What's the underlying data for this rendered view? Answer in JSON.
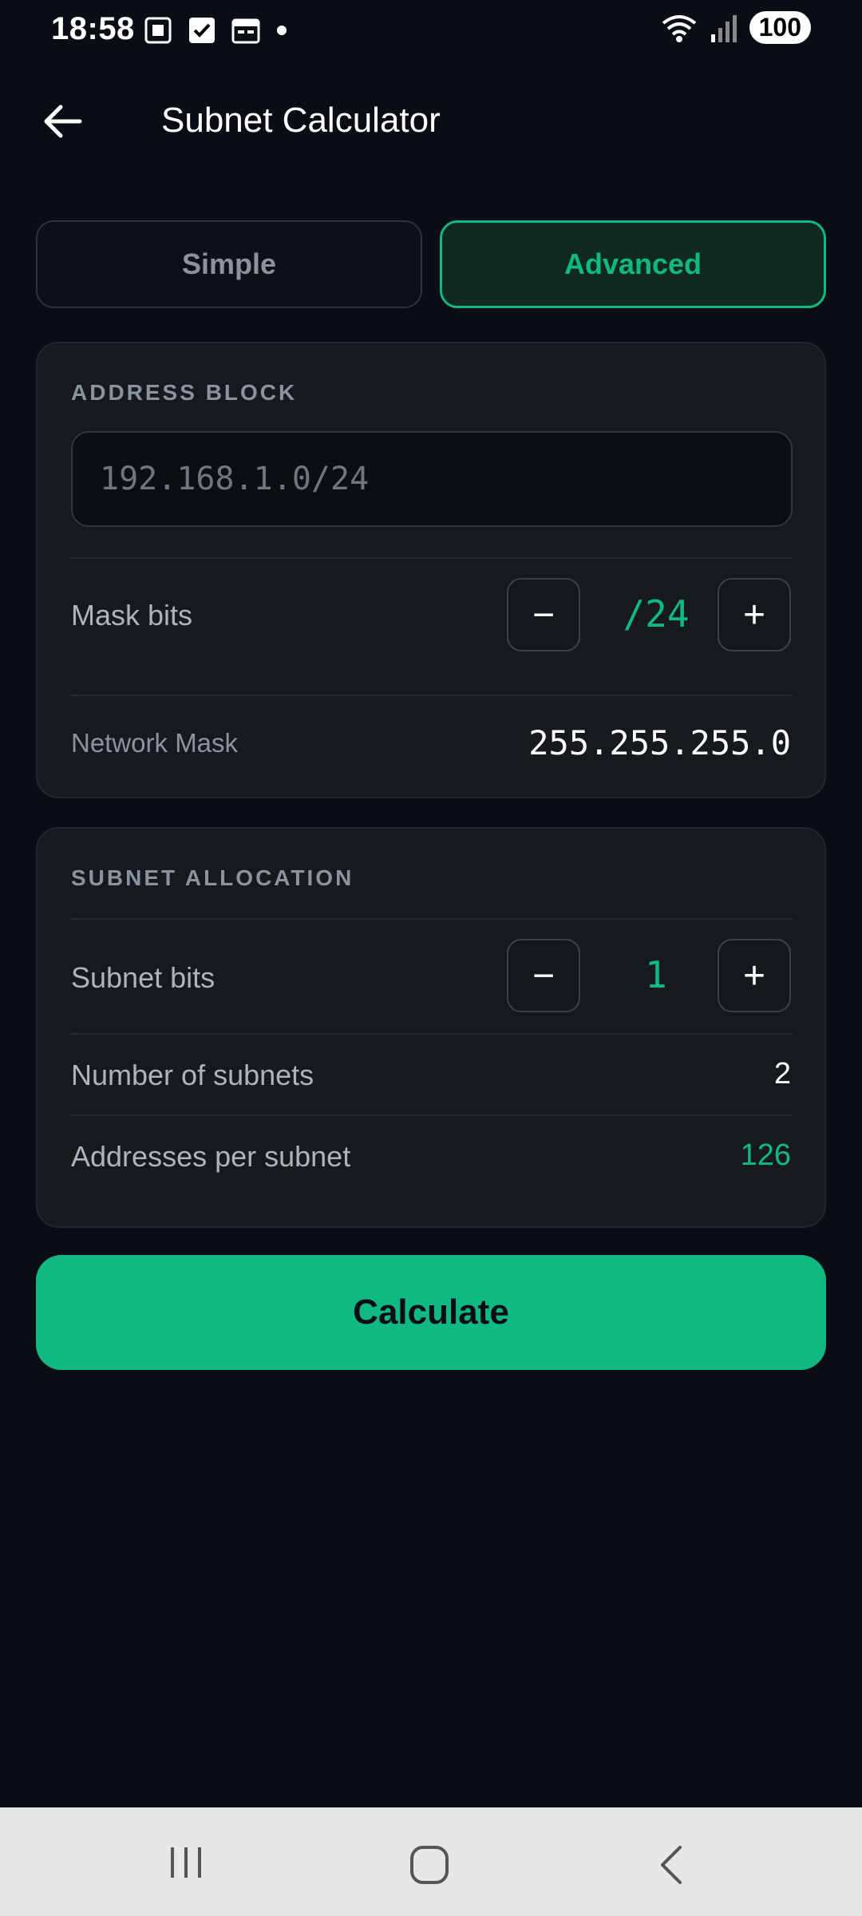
{
  "status_bar": {
    "time": "18:58",
    "battery": "100",
    "signal_label": "R",
    "wifi_label": "5"
  },
  "app_bar": {
    "title": "Subnet Calculator",
    "back_icon": "arrow-left-icon"
  },
  "tabs": [
    {
      "label": "Simple",
      "active": false
    },
    {
      "label": "Advanced",
      "active": true
    }
  ],
  "address_block": {
    "section_title": "ADDRESS BLOCK",
    "input_placeholder": "192.168.1.0/24",
    "input_value": "",
    "mask_bits_label": "Mask bits",
    "mask_bits_value": "/24",
    "network_mask_label": "Network Mask",
    "network_mask_value": "255.255.255.0",
    "minus": "−",
    "plus": "+"
  },
  "subnet_allocation": {
    "section_title": "SUBNET ALLOCATION",
    "subnet_bits_label": "Subnet bits",
    "subnet_bits_value": "1",
    "num_subnets_label": "Number of subnets",
    "num_subnets_value": "2",
    "addr_per_subnet_label": "Addresses per subnet",
    "addr_per_subnet_value": "126",
    "minus": "−",
    "plus": "+"
  },
  "calculate_label": "Calculate",
  "colors": {
    "accent": "#10b981",
    "background": "#0a0e14",
    "card": "#161a1f"
  }
}
